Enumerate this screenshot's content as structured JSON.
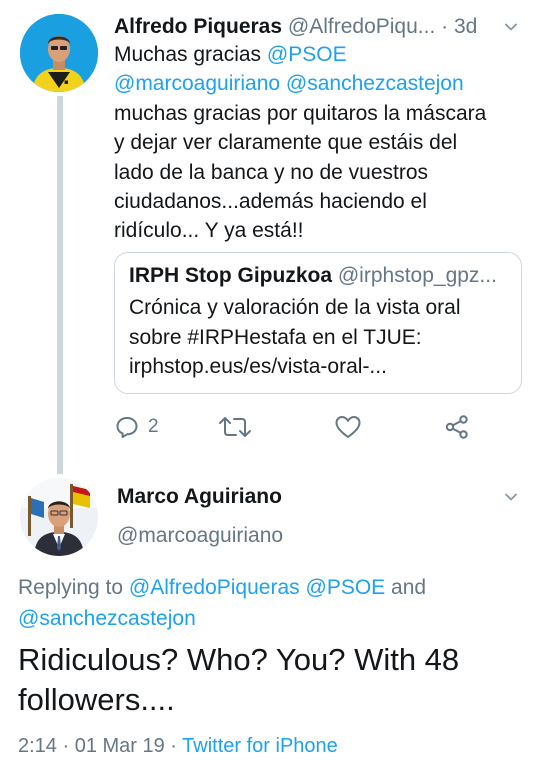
{
  "tweet1": {
    "name": "Alfredo Piqueras",
    "handle": "@AlfredoPiqu...",
    "time": "· 3d",
    "body": {
      "mention_psoe": "@PSOE",
      "prefix": "Muchas gracias ",
      "mention_marco": "@marcoaguiriano",
      "mention_sanchez": "@sanchezcastejon",
      "line3": "muchas gracias por quitaros la máscara",
      "line4": "y dejar ver claramente que estáis del",
      "line5": "lado de la banca y no de vuestros",
      "line6": "ciudadanos...además haciendo el",
      "line7": "ridículo... Y ya está!!"
    },
    "quote": {
      "name": "IRPH Stop Gipuzkoa",
      "handle": "@irphstop_gpz...",
      "line1": "Crónica y valoración de la vista oral",
      "line2": "sobre #IRPHestafa en el TJUE:",
      "line3": "irphstop.eus/es/vista-oral-..."
    },
    "actions": {
      "reply_count": "2",
      "reply_icon": "reply-icon",
      "retweet_icon": "retweet-icon",
      "like_icon": "heart-icon",
      "share_icon": "share-icon"
    }
  },
  "tweet2": {
    "name": "Marco Aguiriano",
    "handle": "@marcoaguiriano",
    "replying_prefix": "Replying to ",
    "replying_user1": "@AlfredoPiqueras",
    "replying_user2": "@PSOE",
    "replying_and": " and",
    "replying_user3": "@sanchezcastejon",
    "text_line1": "Ridiculous? Who? You? With 48",
    "text_line2": "followers....",
    "time": "2:14 · 01 Mar 19 · ",
    "source": "Twitter for iPhone"
  },
  "colors": {
    "accent": "#1da1f2",
    "muted": "#657786",
    "text": "#14171a",
    "border": "#ccd6dd"
  }
}
